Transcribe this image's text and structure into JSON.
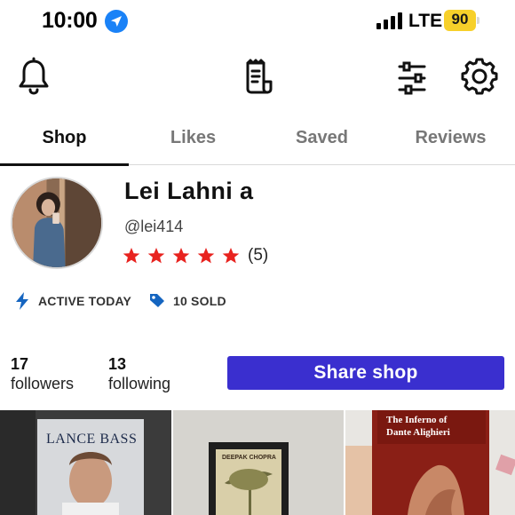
{
  "status_bar": {
    "time": "10:00",
    "network": "LTE",
    "battery": "90",
    "battery_color": "#f7d02a",
    "icons": [
      "location-arrow-icon",
      "signal-bars-icon",
      "battery-icon"
    ]
  },
  "toolbar": {
    "icons": [
      "bell-icon",
      "receipt-icon",
      "filter-sliders-icon",
      "gear-icon"
    ]
  },
  "tabs": [
    {
      "label": "Shop",
      "active": true
    },
    {
      "label": "Likes",
      "active": false
    },
    {
      "label": "Saved",
      "active": false
    },
    {
      "label": "Reviews",
      "active": false
    }
  ],
  "profile": {
    "name": "Lei Lahni a",
    "handle": "@lei414",
    "rating": 5,
    "review_count": "(5)",
    "star_color": "#e8231f",
    "badges": [
      {
        "icon": "lightning-bolt-icon",
        "label": "ACTIVE TODAY"
      },
      {
        "icon": "price-tag-icon",
        "label": "10 SOLD"
      }
    ],
    "badge_icon_color": "#1565c0"
  },
  "stats": {
    "followers_count": "17",
    "followers_label": "followers",
    "following_count": "13",
    "following_label": "following"
  },
  "share_button": {
    "label": "Share shop",
    "color": "#3a2fcf"
  },
  "listings": [
    {
      "title": "LANCE BASS",
      "subtitle": "",
      "icon": "book-cover-image"
    },
    {
      "title": "DEEPAK CHOPRA",
      "subtitle": "",
      "icon": "book-cover-image"
    },
    {
      "title": "The Inferno of",
      "subtitle": "Dante Alighieri",
      "icon": "book-cover-image"
    }
  ]
}
